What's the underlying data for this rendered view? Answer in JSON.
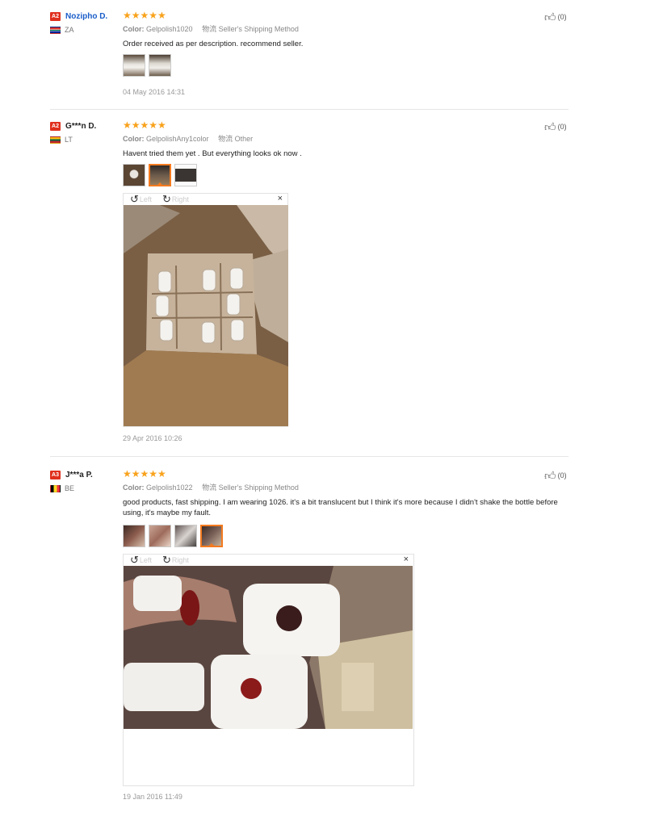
{
  "reviews": [
    {
      "level": "A2",
      "name": "Nozipho D.",
      "country": "ZA",
      "stars": "★★★★★",
      "color_label": "Color:",
      "color_value": "Gelpolish1020",
      "shipping_label": "物流",
      "shipping_value": "Seller's Shipping Method",
      "text": "Order received as per description. recommend seller.",
      "date": "04 May 2016 14:31",
      "likes": "(0)",
      "photo_count": 2
    },
    {
      "level": "A2",
      "name": "G***n D.",
      "country": "LT",
      "stars": "★★★★★",
      "color_label": "Color:",
      "color_value": "GelpolishAny1color",
      "shipping_label": "物流",
      "shipping_value": "Other",
      "text": "Havent tried them yet . But everything looks ok now .",
      "date": "29 Apr 2016 10:26",
      "likes": "(0)",
      "photo_count": 3,
      "viewer": {
        "rotate_left": "Left",
        "rotate_right": "Right",
        "close": "×"
      }
    },
    {
      "level": "A3",
      "name": "J***a P.",
      "country": "BE",
      "stars": "★★★★★",
      "color_label": "Color:",
      "color_value": "Gelpolish1022",
      "shipping_label": "物流",
      "shipping_value": "Seller's Shipping Method",
      "text": "good products, fast shipping. I am wearing 1026. it's a bit translucent but I think it's more because I didn't shake the bottle before using, it's maybe my fault.",
      "date": "19 Jan 2016 11:49",
      "likes": "(0)",
      "photo_count": 4,
      "viewer": {
        "rotate_left": "Left",
        "rotate_right": "Right",
        "close": "×"
      }
    }
  ],
  "icons": {
    "rotate_left": "rotate-left-icon",
    "rotate_right": "rotate-right-icon",
    "like": "thumbs-up-icon",
    "close": "close-icon"
  },
  "colors": {
    "star": "#f8a21b",
    "badge": "#e0301e",
    "name_link": "#1a5dc9",
    "active_thumb": "#f47b20"
  }
}
